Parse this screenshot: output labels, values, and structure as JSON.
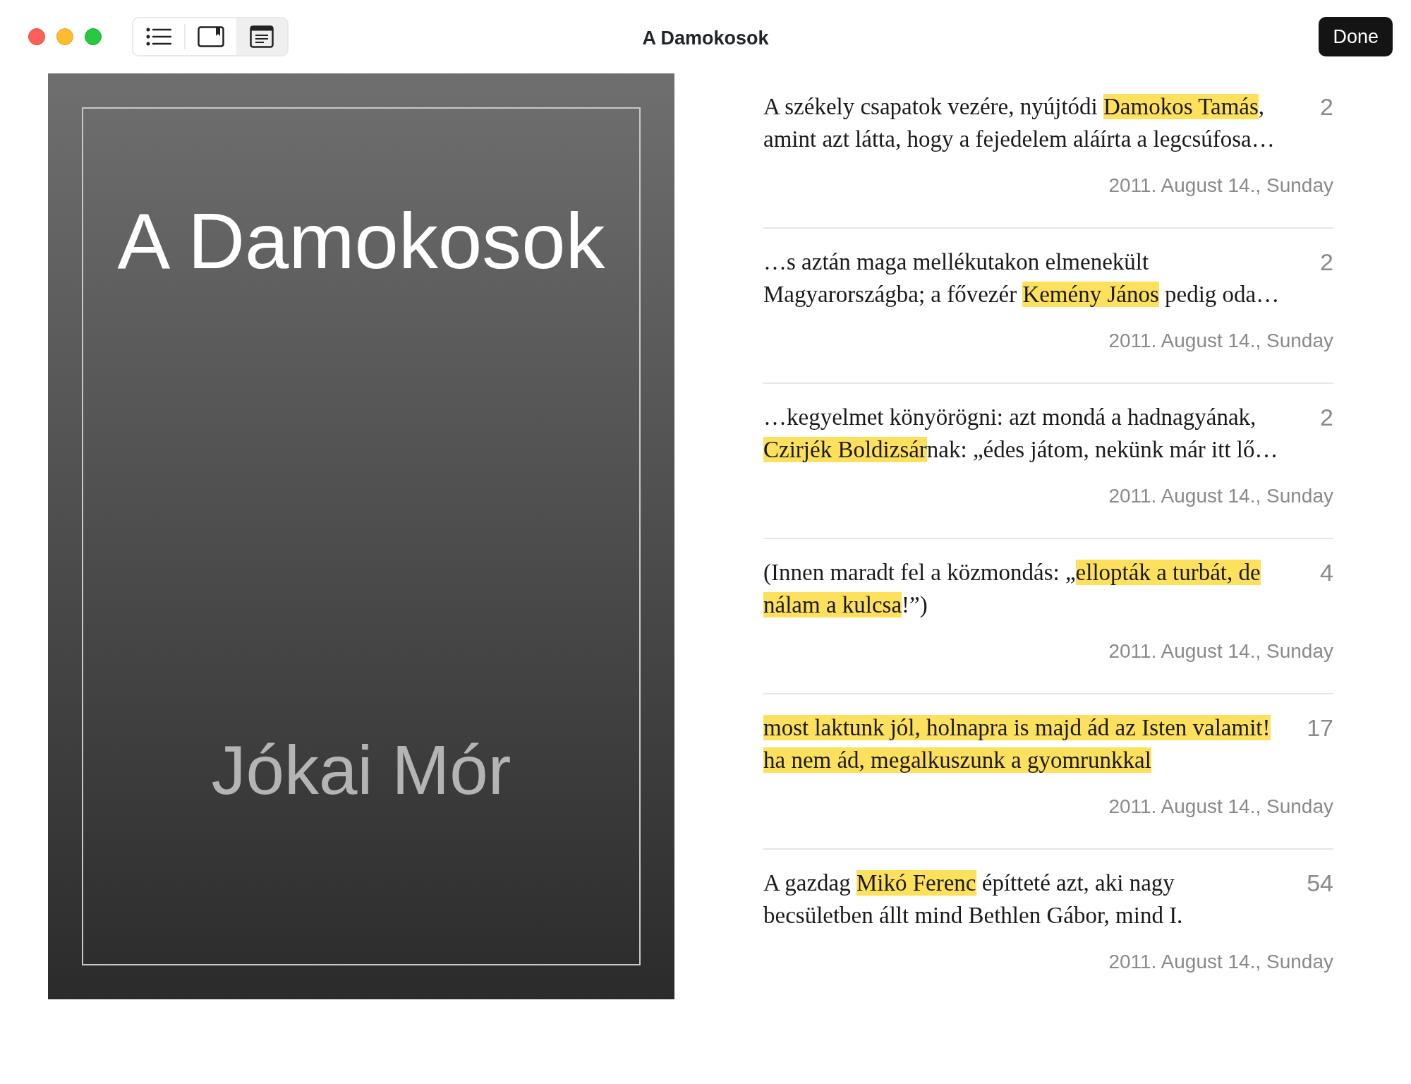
{
  "window": {
    "title": "A Damokosok",
    "done_button": "Done"
  },
  "view_switcher": [
    {
      "kind": "list",
      "selected": false
    },
    {
      "kind": "bookmark",
      "selected": false
    },
    {
      "kind": "notes",
      "selected": true
    }
  ],
  "cover": {
    "title": "A Damokosok",
    "author": "Jókai Mór"
  },
  "notes": [
    {
      "lines": [
        [
          {
            "text": "A székely csapatok vezére, nyújtódi ",
            "highlighted": false
          },
          {
            "text": "Damokos Tamás",
            "highlighted": true
          },
          {
            "text": ",",
            "highlighted": false
          }
        ],
        [
          {
            "text": "amint azt látta, hogy a fejedelem aláírta a legcsúfosa…",
            "highlighted": false
          }
        ]
      ],
      "page": "2",
      "date": "2011. August 14., Sunday"
    },
    {
      "lines": [
        [
          {
            "text": "…s aztán maga mellékutakon elmenekült",
            "highlighted": false
          }
        ],
        [
          {
            "text": "Magyarországba; a fővezér ",
            "highlighted": false
          },
          {
            "text": "Kemény János",
            "highlighted": true
          },
          {
            "text": " pedig oda…",
            "highlighted": false
          }
        ]
      ],
      "page": "2",
      "date": "2011. August 14., Sunday"
    },
    {
      "lines": [
        [
          {
            "text": "…kegyelmet könyörögni: azt mondá a hadnagyának,",
            "highlighted": false
          }
        ],
        [
          {
            "text": "Czirjék Boldizsár",
            "highlighted": true
          },
          {
            "text": "nak: „édes játom, nekünk már itt lő…",
            "highlighted": false
          }
        ]
      ],
      "page": "2",
      "date": "2011. August 14., Sunday"
    },
    {
      "lines": [
        [
          {
            "text": "(Innen maradt fel a közmondás: „",
            "highlighted": false
          },
          {
            "text": "ellopták a turbát, de ",
            "highlighted": true
          }
        ],
        [
          {
            "text": "nálam a kulcsa",
            "highlighted": true
          },
          {
            "text": "!”)",
            "highlighted": false
          }
        ]
      ],
      "page": "4",
      "date": "2011. August 14., Sunday"
    },
    {
      "lines": [
        [
          {
            "text": "most laktunk jól, holnapra is majd ád az Isten valamit!",
            "highlighted": true
          }
        ],
        [
          {
            "text": "ha nem ád, megalkuszunk a gyomrunkkal",
            "highlighted": true
          }
        ]
      ],
      "page": "17",
      "date": "2011. August 14., Sunday"
    },
    {
      "lines": [
        [
          {
            "text": "A gazdag ",
            "highlighted": false
          },
          {
            "text": "Mikó Ferenc",
            "highlighted": true
          },
          {
            "text": " építteté azt, aki nagy",
            "highlighted": false
          }
        ],
        [
          {
            "text": "becsületben állt mind Bethlen Gábor, mind I.",
            "highlighted": false
          }
        ]
      ],
      "page": "54",
      "date": "2011. August 14., Sunday"
    }
  ]
}
